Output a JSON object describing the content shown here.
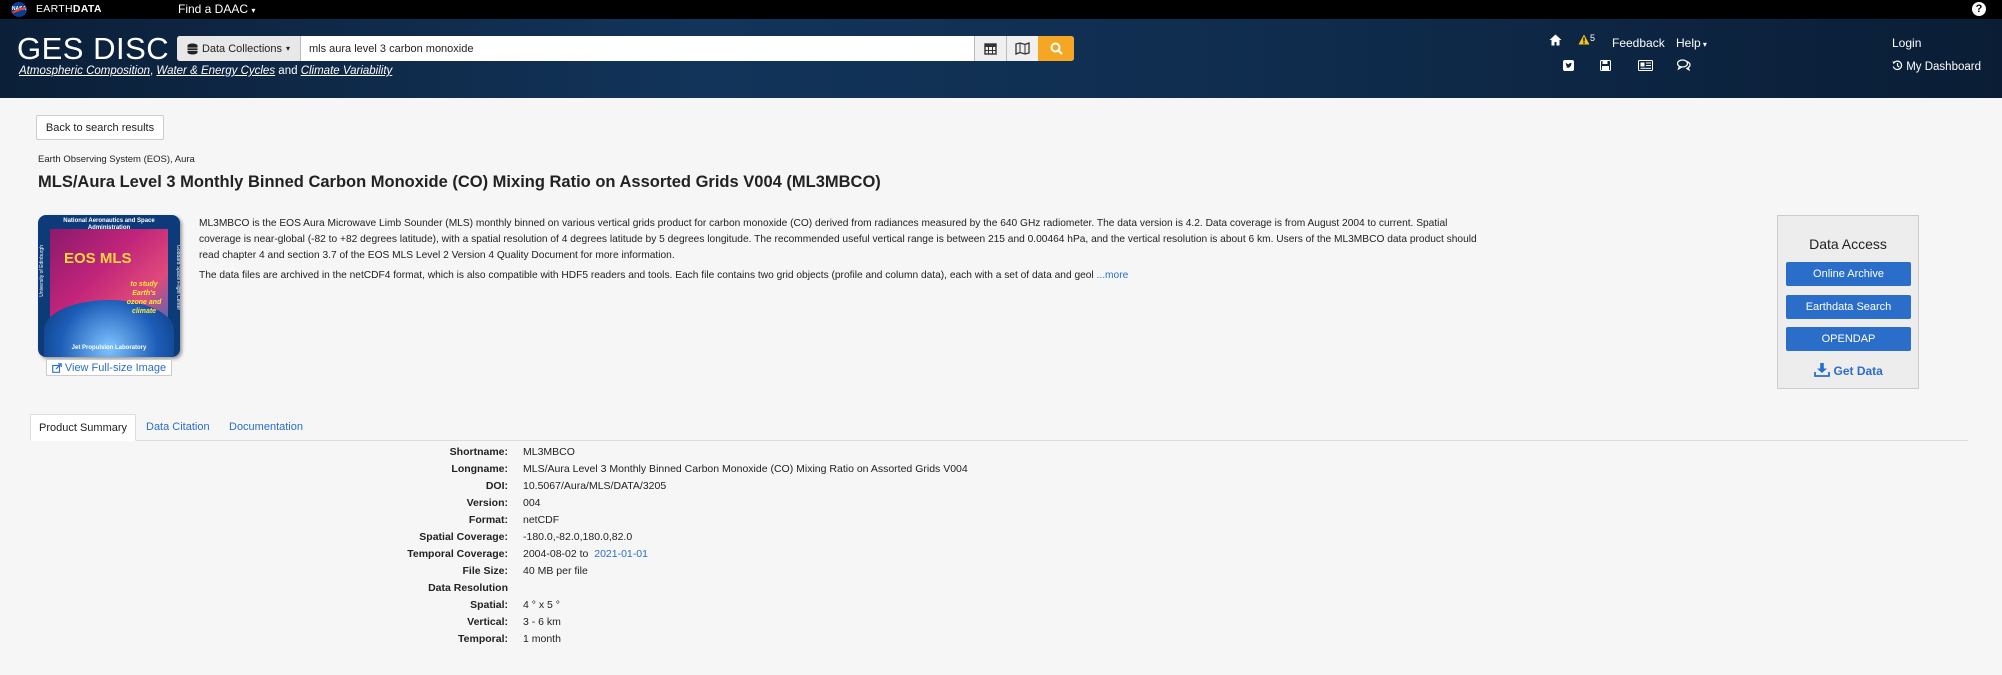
{
  "topbar": {
    "nasa_logo": "NASA",
    "brand_prefix": "EARTH",
    "brand_suffix": "DATA",
    "find_daac": "Find a DAAC",
    "help_glyph": "?"
  },
  "header": {
    "site_title": "GES DISC",
    "tagline_links": [
      "Atmospheric Composition",
      "Water & Energy Cycles",
      "Climate Variability"
    ],
    "tagline_and": "and",
    "collections_label": "Data Collections",
    "search_value": "mls aura level 3 carbon monoxide",
    "alert_count": "5",
    "feedback": "Feedback",
    "help": "Help",
    "login": "Login",
    "dashboard": "My Dashboard",
    "accent_color": "#f5a623"
  },
  "page": {
    "back_label": "Back to search results",
    "breadcrumb": "Earth Observing System (EOS), Aura",
    "title": "MLS/Aura Level 3 Monthly Binned Carbon Monoxide (CO) Mixing Ratio on Assorted Grids V004 (ML3MBCO)",
    "thumbnail": {
      "top_text": "National Aeronautics and Space Administration",
      "main_text": "EOS MLS",
      "sub_text": "to study Earth's ozone and climate",
      "bottom_text": "Jet Propulsion Laboratory",
      "left_text": "University of Edinburgh",
      "right_text": "Goddard Space Flight Center"
    },
    "fullsize_label": "View Full-size Image",
    "abstract_p1": "ML3MBCO is the EOS Aura Microwave Limb Sounder (MLS) monthly binned on various vertical grids product for carbon monoxide (CO) derived from radiances measured by the 640 GHz radiometer. The data version is 4.2. Data coverage is from August 2004 to current. Spatial coverage is near-global (-82 to +82 degrees latitude), with a spatial resolution of 4 degrees latitude by 5 degrees longitude. The recommended useful vertical range is between 215 and 0.00464 hPa, and the vertical resolution is about 6 km. Users of the ML3MBCO data product should read chapter 4 and section 3.7 of the EOS MLS Level 2 Version 4 Quality Document for more information.",
    "abstract_p2": "The data files are archived in the netCDF4 format, which is also compatible with HDF5 readers and tools. Each file contains two grid objects (profile and column data), each with a set of data and geol",
    "more_label": "...more"
  },
  "access": {
    "title": "Data Access",
    "buttons": [
      "Online Archive",
      "Earthdata Search",
      "OPENDAP"
    ],
    "get_data": "Get Data"
  },
  "tabs": [
    "Product Summary",
    "Data Citation",
    "Documentation"
  ],
  "summary": [
    {
      "label": "Shortname:",
      "value": "ML3MBCO"
    },
    {
      "label": "Longname:",
      "value": "MLS/Aura Level 3 Monthly Binned Carbon Monoxide (CO) Mixing Ratio on Assorted Grids V004"
    },
    {
      "label": "DOI:",
      "value": "10.5067/Aura/MLS/DATA/3205"
    },
    {
      "label": "Version:",
      "value": "004"
    },
    {
      "label": "Format:",
      "value": "netCDF"
    },
    {
      "label": "Spatial Coverage:",
      "value": "-180.0,-82.0,180.0,82.0"
    },
    {
      "label": "Temporal Coverage:",
      "value": "2004-08-02 to",
      "link": "2021-01-01"
    },
    {
      "label": "File Size:",
      "value": "40 MB per file"
    },
    {
      "label": "Data Resolution",
      "value": ""
    },
    {
      "label": "Spatial:",
      "value": "4 ° x 5 °"
    },
    {
      "label": "Vertical:",
      "value": "3 - 6 km"
    },
    {
      "label": "Temporal:",
      "value": "1 month"
    }
  ]
}
